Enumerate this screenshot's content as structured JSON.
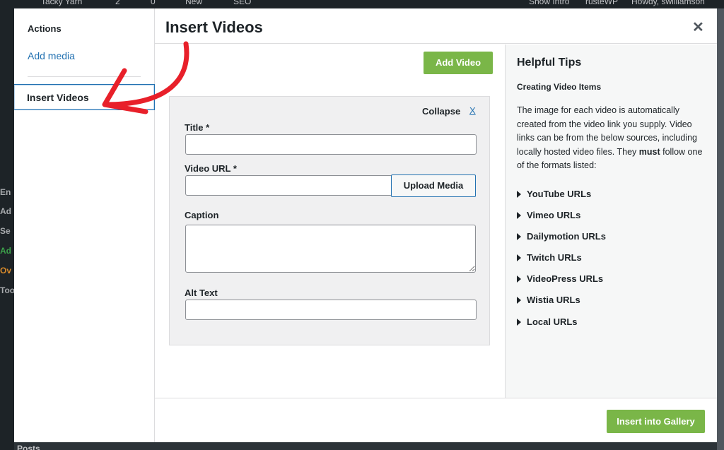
{
  "admin_bar": {
    "site_name": "Tacky Yarn",
    "comments_count": "2",
    "pending_count": "0",
    "new_label": "New",
    "seo_label": "SEO",
    "show_intro": "Show Intro",
    "user_short": "rusteWP",
    "howdy": "Howdy, swilliamson"
  },
  "wp_sidebar": {
    "items": [
      "En",
      "Ad",
      "Se",
      "Ad",
      "Ov",
      "Too"
    ]
  },
  "background_footer": "Posts",
  "modal": {
    "sidebar": {
      "heading": "Actions",
      "add_media": "Add media",
      "insert_videos": "Insert Videos"
    },
    "title": "Insert Videos",
    "close_icon": "close-icon",
    "add_video_button": "Add Video",
    "video_item": {
      "collapse_label": "Collapse",
      "collapse_x": "X",
      "title_label": "Title *",
      "title_value": "",
      "url_label": "Video URL *",
      "url_value": "",
      "upload_button": "Upload Media",
      "caption_label": "Caption",
      "caption_value": "",
      "alt_label": "Alt Text",
      "alt_value": ""
    },
    "tips": {
      "heading": "Helpful Tips",
      "subheading": "Creating Video Items",
      "text_before": "The image for each video is automatically created from the video link you supply. Video links can be from the below sources, including locally hosted video files. They ",
      "text_bold": "must",
      "text_after": " follow one of the formats listed:",
      "items": [
        "YouTube URLs",
        "Vimeo URLs",
        "Dailymotion URLs",
        "Twitch URLs",
        "VideoPress URLs",
        "Wistia URLs",
        "Local URLs"
      ]
    },
    "footer_button": "Insert into Gallery"
  },
  "colors": {
    "accent": "#2271b1",
    "button_green": "#7ab648",
    "annotation_arrow": "#e8202a",
    "admin_dark": "#1d2327"
  }
}
